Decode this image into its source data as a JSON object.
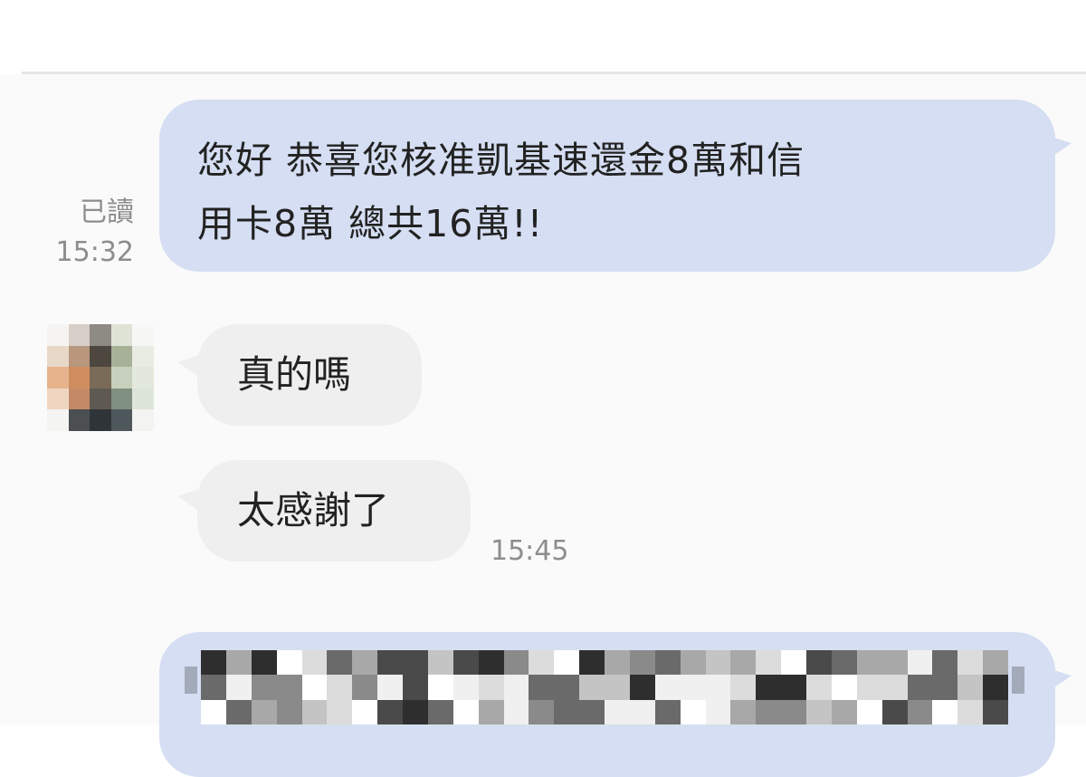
{
  "chat": {
    "messages": [
      {
        "direction": "outgoing",
        "lines": [
          "您好 恭喜您核准凱基速還金8萬和信",
          "用卡8萬 總共16萬!!"
        ],
        "read_status": "已讀",
        "time": "15:32"
      },
      {
        "direction": "incoming",
        "text": "真的嗎"
      },
      {
        "direction": "incoming",
        "text": "太感謝了",
        "time": "15:45"
      },
      {
        "direction": "outgoing",
        "text": "",
        "redacted": true
      }
    ],
    "colors": {
      "outgoing_bubble": "#d5def2",
      "incoming_bubble": "#efefef",
      "meta_text": "#8d8d8d",
      "message_text": "#222222"
    }
  }
}
